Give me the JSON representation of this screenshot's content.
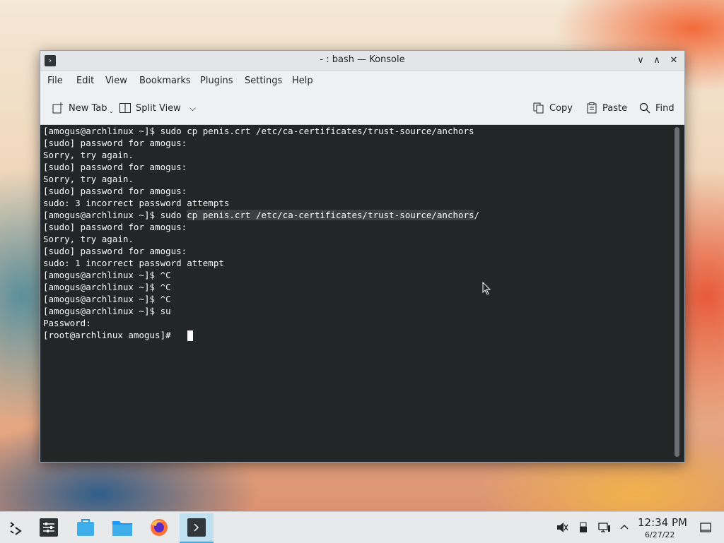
{
  "window": {
    "title": "- : bash — Konsole",
    "buttons": {
      "minimize": "∨",
      "maximize": "∧",
      "close": "✕"
    }
  },
  "menubar": {
    "items": [
      "File",
      "Edit",
      "View",
      "Bookmarks",
      "Plugins",
      "Settings",
      "Help"
    ]
  },
  "toolbar": {
    "new_tab": "New Tab",
    "split_view": "Split View",
    "copy": "Copy",
    "paste": "Paste",
    "find": "Find"
  },
  "terminal": {
    "lines": [
      "[amogus@archlinux ~]$ sudo cp penis.crt /etc/ca-certificates/trust-source/anchors",
      "[sudo] password for amogus:",
      "Sorry, try again.",
      "[sudo] password for amogus:",
      "Sorry, try again.",
      "[sudo] password for amogus:",
      "sudo: 3 incorrect password attempts",
      "[amogus@archlinux ~]$ sudo cp penis.crt /etc/ca-certificates/trust-source/anchors/",
      "[sudo] password for amogus:",
      "Sorry, try again.",
      "[sudo] password for amogus:",
      "sudo: 1 incorrect password attempt",
      "[amogus@archlinux ~]$ ^C",
      "[amogus@archlinux ~]$ ^C",
      "[amogus@archlinux ~]$ ^C",
      "[amogus@archlinux ~]$ su",
      "Password:",
      "[root@archlinux amogus]# "
    ],
    "selected_line_prefix": "[amogus@archlinux ~]$ sudo ",
    "selected_text": "cp penis.crt /etc/ca-certificates/trust-source/anchors",
    "selected_line_suffix": "/"
  },
  "taskbar": {
    "apps": [
      "application-launcher-icon",
      "system-settings-icon",
      "discover-icon",
      "file-manager-icon",
      "firefox-icon",
      "konsole-icon"
    ],
    "clock": {
      "time": "12:34 PM",
      "date": "6/27/22"
    }
  },
  "colors": {
    "terminal_bg": "#232627",
    "terminal_fg": "#fcfcfc",
    "accent": "#3daee9"
  }
}
